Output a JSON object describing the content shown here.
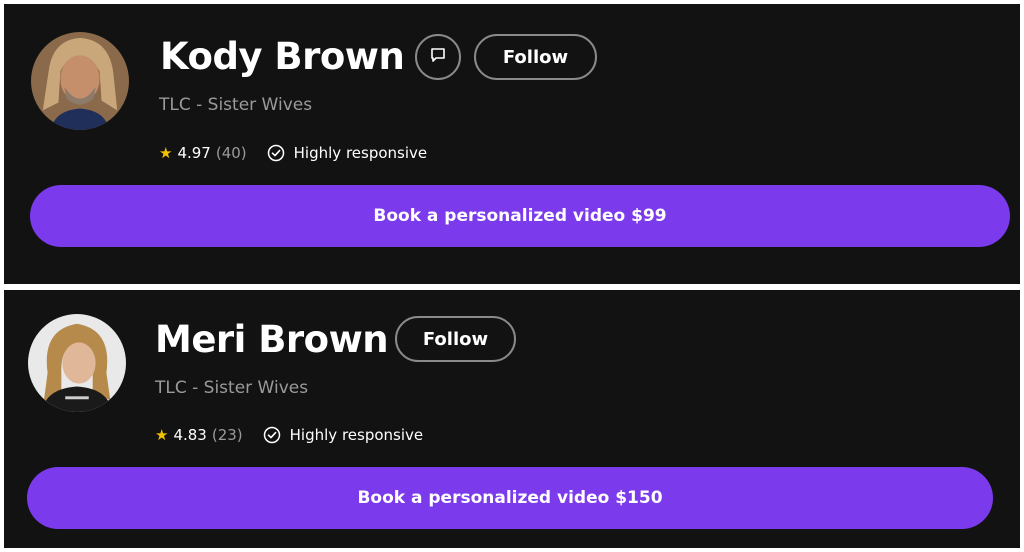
{
  "colors": {
    "card_background": "#121212",
    "accent": "#7c3aed",
    "star": "#f2c200",
    "muted_text": "#9a9a9a",
    "button_border": "#8a8a8a"
  },
  "profiles": [
    {
      "name": "Kody Brown",
      "subtitle": "TLC - Sister Wives",
      "has_message_button": true,
      "message_icon": "message-icon",
      "follow_label": "Follow",
      "star_icon": "star-icon",
      "rating": "4.97",
      "review_count": "(40)",
      "check_icon": "check-circle-icon",
      "responsive_label": "Highly responsive",
      "book_label": "Book a personalized video $99"
    },
    {
      "name": "Meri Brown",
      "subtitle": "TLC - Sister Wives",
      "has_message_button": false,
      "follow_label": "Follow",
      "star_icon": "star-icon",
      "rating": "4.83",
      "review_count": "(23)",
      "check_icon": "check-circle-icon",
      "responsive_label": "Highly responsive",
      "book_label": "Book a personalized video $150"
    }
  ]
}
